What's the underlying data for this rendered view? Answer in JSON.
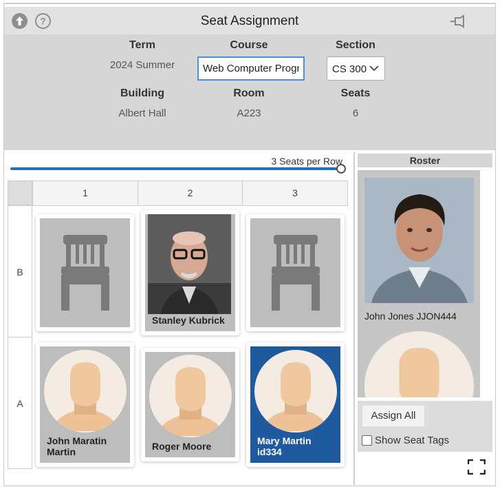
{
  "header": {
    "title": "Seat Assignment"
  },
  "info": {
    "term_label": "Term",
    "term_value": "2024 Summer",
    "course_label": "Course",
    "course_value": "Web Computer Progra",
    "section_label": "Section",
    "section_value": "CS 300",
    "building_label": "Building",
    "building_value": "Albert Hall",
    "room_label": "Room",
    "room_value": "A223",
    "seats_label": "Seats",
    "seats_value": "6"
  },
  "grid": {
    "seats_per_row_label": "3 Seats per Row",
    "slider_level": 1.0,
    "columns": [
      "1",
      "2",
      "3"
    ],
    "rows": [
      "B",
      "A"
    ],
    "seats": {
      "b1": "",
      "b2": "Stanley Kubrick",
      "b3": "",
      "a1": "John Maratin Martin",
      "a2": "Roger Moore",
      "a3": "Mary Martin id334"
    }
  },
  "roster": {
    "title": "Roster",
    "students": [
      "John Jones JJON444"
    ],
    "assign_all": "Assign All",
    "show_seat_tags": "Show Seat Tags"
  },
  "colors": {
    "accent": "#1a73c7",
    "selected_seat": "#1f5a9e",
    "panel": "#d6d6d6"
  }
}
